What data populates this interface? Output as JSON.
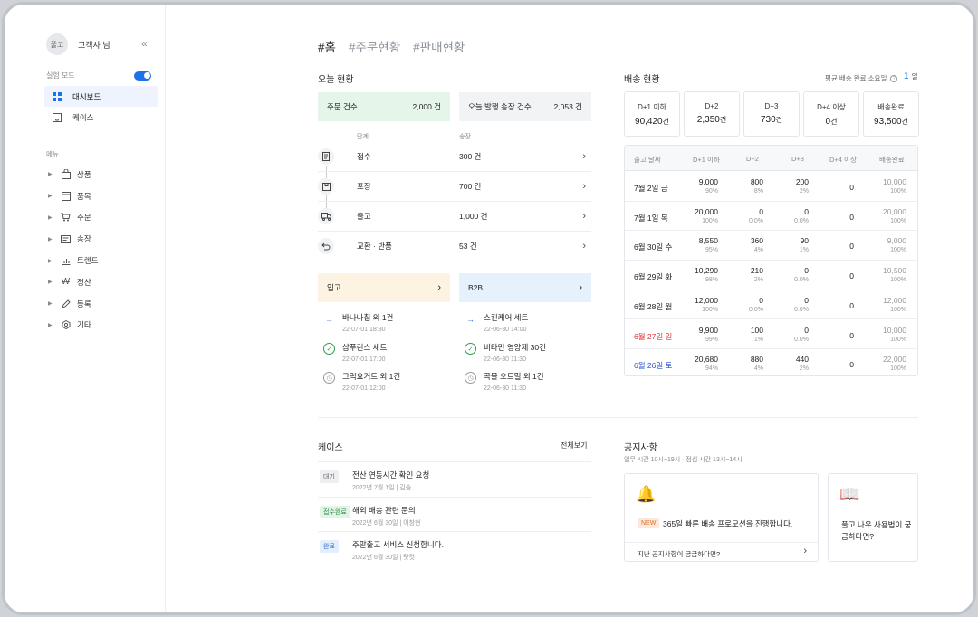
{
  "sidebar": {
    "avatar_text": "풀고",
    "username": "고객사 님",
    "collapse_icon": "«",
    "mode_label": "실험 모드",
    "mode_on": true,
    "top_items": [
      {
        "label": "대시보드",
        "active": true
      },
      {
        "label": "케이스",
        "active": false
      }
    ],
    "menu_title": "메뉴",
    "menu": [
      {
        "label": "상품",
        "icon": "bag-icon"
      },
      {
        "label": "품목",
        "icon": "box-icon"
      },
      {
        "label": "주문",
        "icon": "cart-icon"
      },
      {
        "label": "송장",
        "icon": "invoice-icon"
      },
      {
        "label": "트렌드",
        "icon": "chart-icon"
      },
      {
        "label": "정산",
        "icon": "won-icon"
      },
      {
        "label": "등록",
        "icon": "pen-icon"
      },
      {
        "label": "기타",
        "icon": "gear-icon"
      }
    ]
  },
  "tabs": [
    "#홈",
    "#주문현황",
    "#판매현황"
  ],
  "today": {
    "title": "오늘 현황",
    "orders_label": "주문 건수",
    "orders_value": "2,000 건",
    "invoice_label": "오늘 발행 송장 건수",
    "invoice_value": "2,053 건",
    "col_stage": "단계",
    "col_invoice": "송장",
    "steps": [
      {
        "name": "접수",
        "value": "300 건"
      },
      {
        "name": "포장",
        "value": "700 건"
      },
      {
        "name": "출고",
        "value": "1,000 건"
      },
      {
        "name": "교환 · 반품",
        "value": "53 건"
      }
    ],
    "inbound_label": "입고",
    "b2b_label": "B2B",
    "inbound": [
      {
        "title": "바나나칩 외 1건",
        "time": "22-07-01 18:30",
        "status": "arrow"
      },
      {
        "title": "샴푸린스 세트",
        "time": "22-07-01 17:00",
        "status": "check"
      },
      {
        "title": "그릭요거트 외 1건",
        "time": "22-07-01 12:00",
        "status": "clock"
      }
    ],
    "b2b": [
      {
        "title": "스킨케어 세트",
        "time": "22-06-30 14:00",
        "status": "arrow"
      },
      {
        "title": "비타민 영양제 30건",
        "time": "22-06-30 11:30",
        "status": "check"
      },
      {
        "title": "곡물 오트밀 외 1건",
        "time": "22-06-30 11:30",
        "status": "clock"
      }
    ]
  },
  "delivery": {
    "title": "배송 현황",
    "avg_label": "평균 배송 완료 소요일",
    "avg_value": "1",
    "avg_unit": "일",
    "cards": [
      {
        "label": "D+1 이하",
        "value": "90,420",
        "unit": "건"
      },
      {
        "label": "D+2",
        "value": "2,350",
        "unit": "건"
      },
      {
        "label": "D+3",
        "value": "730",
        "unit": "건"
      },
      {
        "label": "D+4 이상",
        "value": "0",
        "unit": "건"
      },
      {
        "label": "배송완료",
        "value": "93,500",
        "unit": "건"
      }
    ],
    "headers": [
      "출고 날짜",
      "D+1 이하",
      "D+2",
      "D+3",
      "D+4 이상",
      "배송완료"
    ],
    "rows": [
      {
        "date": "7월 2일 금",
        "color": "#222222",
        "d1": "9,000",
        "d1p": "90%",
        "d2": "800",
        "d2p": "8%",
        "d3": "200",
        "d3p": "2%",
        "d4": "0",
        "done": "10,000",
        "donep": "100%"
      },
      {
        "date": "7월 1일 목",
        "color": "#222222",
        "d1": "20,000",
        "d1p": "100%",
        "d2": "0",
        "d2p": "0.0%",
        "d3": "0",
        "d3p": "0.0%",
        "d4": "0",
        "done": "20,000",
        "donep": "100%"
      },
      {
        "date": "6월 30일 수",
        "color": "#222222",
        "d1": "8,550",
        "d1p": "95%",
        "d2": "360",
        "d2p": "4%",
        "d3": "90",
        "d3p": "1%",
        "d4": "0",
        "done": "9,000",
        "donep": "100%"
      },
      {
        "date": "6월 29일 화",
        "color": "#222222",
        "d1": "10,290",
        "d1p": "98%",
        "d2": "210",
        "d2p": "2%",
        "d3": "0",
        "d3p": "0.0%",
        "d4": "0",
        "done": "10,500",
        "donep": "100%"
      },
      {
        "date": "6월 28일 월",
        "color": "#222222",
        "d1": "12,000",
        "d1p": "100%",
        "d2": "0",
        "d2p": "0.0%",
        "d3": "0",
        "d3p": "0.0%",
        "d4": "0",
        "done": "12,000",
        "donep": "100%"
      },
      {
        "date": "6월 27일 일",
        "color": "#e0333a",
        "d1": "9,900",
        "d1p": "99%",
        "d2": "100",
        "d2p": "1%",
        "d3": "0",
        "d3p": "0.0%",
        "d4": "0",
        "done": "10,000",
        "donep": "100%"
      },
      {
        "date": "6월 26일 토",
        "color": "#2b4fc8",
        "d1": "20,680",
        "d1p": "94%",
        "d2": "880",
        "d2p": "4%",
        "d3": "440",
        "d3p": "2%",
        "d4": "0",
        "done": "22,000",
        "donep": "100%"
      }
    ]
  },
  "cases": {
    "title": "케이스",
    "view_all": "전체보기",
    "items": [
      {
        "badge": "대기",
        "badge_bg": "#eeeff1",
        "badge_fg": "#666666",
        "title": "전산 연동시간 확인 요청",
        "meta": "2022년 7월 1일 | 김솔"
      },
      {
        "badge": "접수완료",
        "badge_bg": "#e3f4e7",
        "badge_fg": "#2e8b4a",
        "title": "해외 배송 관련 문의",
        "meta": "2022년 6월 30일 | 이창현"
      },
      {
        "badge": "완료",
        "badge_bg": "#e4eefc",
        "badge_fg": "#2f6fd6",
        "title": "주말출고 서비스 신청합니다.",
        "meta": "2022년 6월 30일 | 랏컷"
      }
    ]
  },
  "notice": {
    "title": "공지사항",
    "hours": "업무 시간 10시~19시 · 점심 시간 13시~14시",
    "new_badge": "NEW",
    "text": "365일 빠른 배송 프로모션을 진행합니다.",
    "past": "지난 공지사항이 궁금하다면?",
    "guide": "풀고 나우 사용법이 궁금하다면?"
  }
}
